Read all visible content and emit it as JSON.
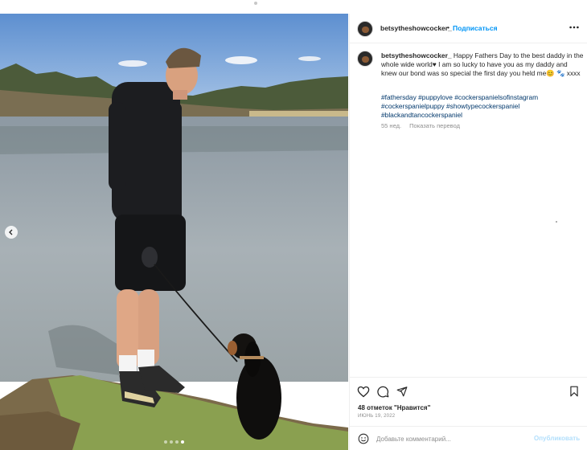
{
  "post": {
    "username": "betsytheshowcocker_",
    "separator": "•",
    "follow_label": "Подписаться",
    "more_icon": "more-horizontal-icon",
    "caption_text": " Happy Fathers Day to the best daddy in the whole wide world♥ I am so lucky to have you as my daddy and knew our bond was so special the first day you held me😊 🐾 xxxx",
    "hashtags": [
      "#fathersday",
      "#puppylove",
      "#cockerspanielsofinstagram",
      "#cockerspanielpuppy",
      "#showtypecockerspaniel",
      "#blackandtancockerspaniel"
    ],
    "age": "55 нед.",
    "translate_label": "Показать перевод",
    "likes_text": "48 отметок \"Нравится\"",
    "date_text": "ИЮНЬ 19, 2022",
    "comment_placeholder": "Добавьте комментарий...",
    "post_button_label": "Опубликовать"
  },
  "carousel": {
    "slide_count": 4,
    "active_slide": 4,
    "prev_icon": "chevron-left-icon"
  },
  "colors": {
    "accent": "#0095f6",
    "hashtag": "#00376b",
    "muted": "#8e8e8e",
    "post_disabled": "#b2dffc"
  },
  "icons": [
    "heart-icon",
    "comment-icon",
    "share-icon",
    "bookmark-icon",
    "emoji-icon"
  ]
}
